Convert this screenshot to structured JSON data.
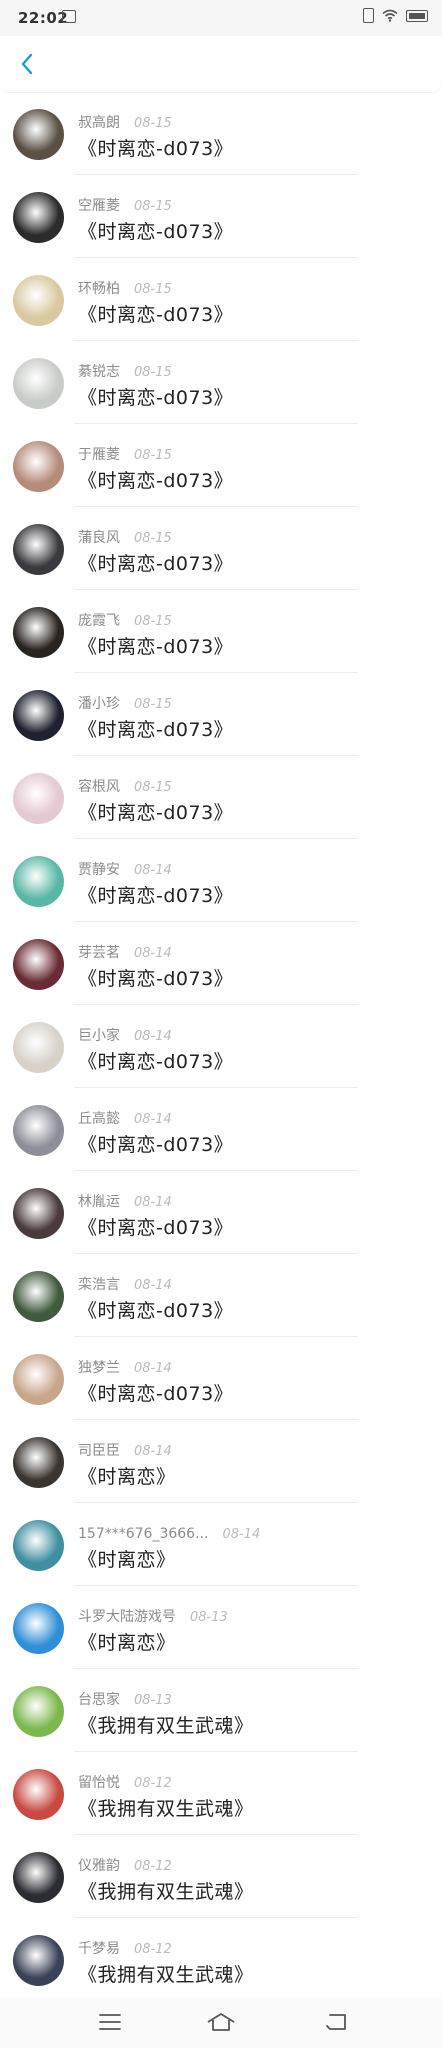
{
  "status_bar": {
    "time": "22:02",
    "app_icon": "notification-app-icon",
    "icons": [
      "sim-icon",
      "wifi-icon",
      "battery-icon"
    ]
  },
  "nav": {
    "back_icon": "chevron-left-icon",
    "accent_color": "#1a9bd7"
  },
  "items": [
    {
      "sender": "叔高朗",
      "date": "08-15",
      "title": "《时离恋-d073》",
      "avatar_color": "#5a5044"
    },
    {
      "sender": "空雁菱",
      "date": "08-15",
      "title": "《时离恋-d073》",
      "avatar_color": "#2b2b2b"
    },
    {
      "sender": "环畅柏",
      "date": "08-15",
      "title": "《时离恋-d073》",
      "avatar_color": "#d9c9a0"
    },
    {
      "sender": "綦锐志",
      "date": "08-15",
      "title": "《时离恋-d073》",
      "avatar_color": "#c8ccc8"
    },
    {
      "sender": "于雁菱",
      "date": "08-15",
      "title": "《时离恋-d073》",
      "avatar_color": "#b58b7a"
    },
    {
      "sender": "蒲良风",
      "date": "08-15",
      "title": "《时离恋-d073》",
      "avatar_color": "#3a3a3e"
    },
    {
      "sender": "庞霞飞",
      "date": "08-15",
      "title": "《时离恋-d073》",
      "avatar_color": "#2a2420"
    },
    {
      "sender": "潘小珍",
      "date": "08-15",
      "title": "《时离恋-d073》",
      "avatar_color": "#1e2230"
    },
    {
      "sender": "容根风",
      "date": "08-15",
      "title": "《时离恋-d073》",
      "avatar_color": "#e3c9d2"
    },
    {
      "sender": "贾静安",
      "date": "08-14",
      "title": "《时离恋-d073》",
      "avatar_color": "#59b8a5"
    },
    {
      "sender": "芽芸茗",
      "date": "08-14",
      "title": "《时离恋-d073》",
      "avatar_color": "#6a2c34"
    },
    {
      "sender": "巨小家",
      "date": "08-14",
      "title": "《时离恋-d073》",
      "avatar_color": "#d7d1c8"
    },
    {
      "sender": "丘高懿",
      "date": "08-14",
      "title": "《时离恋-d073》",
      "avatar_color": "#8d8e98"
    },
    {
      "sender": "林胤运",
      "date": "08-14",
      "title": "《时离恋-d073》",
      "avatar_color": "#4a3a3c"
    },
    {
      "sender": "栾浩言",
      "date": "08-14",
      "title": "《时离恋-d073》",
      "avatar_color": "#3f5a3c"
    },
    {
      "sender": "独梦兰",
      "date": "08-14",
      "title": "《时离恋-d073》",
      "avatar_color": "#c9a58a"
    },
    {
      "sender": "司臣臣",
      "date": "08-14",
      "title": "《时离恋》",
      "avatar_color": "#3b3530"
    },
    {
      "sender": "157***676_3666...",
      "date": "08-14",
      "title": "《时离恋》",
      "avatar_color": "#3f8fa0"
    },
    {
      "sender": "斗罗大陆游戏号",
      "date": "08-13",
      "title": "《时离恋》",
      "avatar_color": "#2f8fd8"
    },
    {
      "sender": "台思家",
      "date": "08-13",
      "title": "《我拥有双生武魂》",
      "avatar_color": "#7cb84e"
    },
    {
      "sender": "留怡悦",
      "date": "08-12",
      "title": "《我拥有双生武魂》",
      "avatar_color": "#c84a42"
    },
    {
      "sender": "仪雅韵",
      "date": "08-12",
      "title": "《我拥有双生武魂》",
      "avatar_color": "#2b2b33"
    },
    {
      "sender": "千梦易",
      "date": "08-12",
      "title": "《我拥有双生武魂》",
      "avatar_color": "#3a4258"
    }
  ],
  "bottom_nav": {
    "menu_icon": "menu-icon",
    "home_icon": "home-icon",
    "back_icon": "return-icon"
  }
}
